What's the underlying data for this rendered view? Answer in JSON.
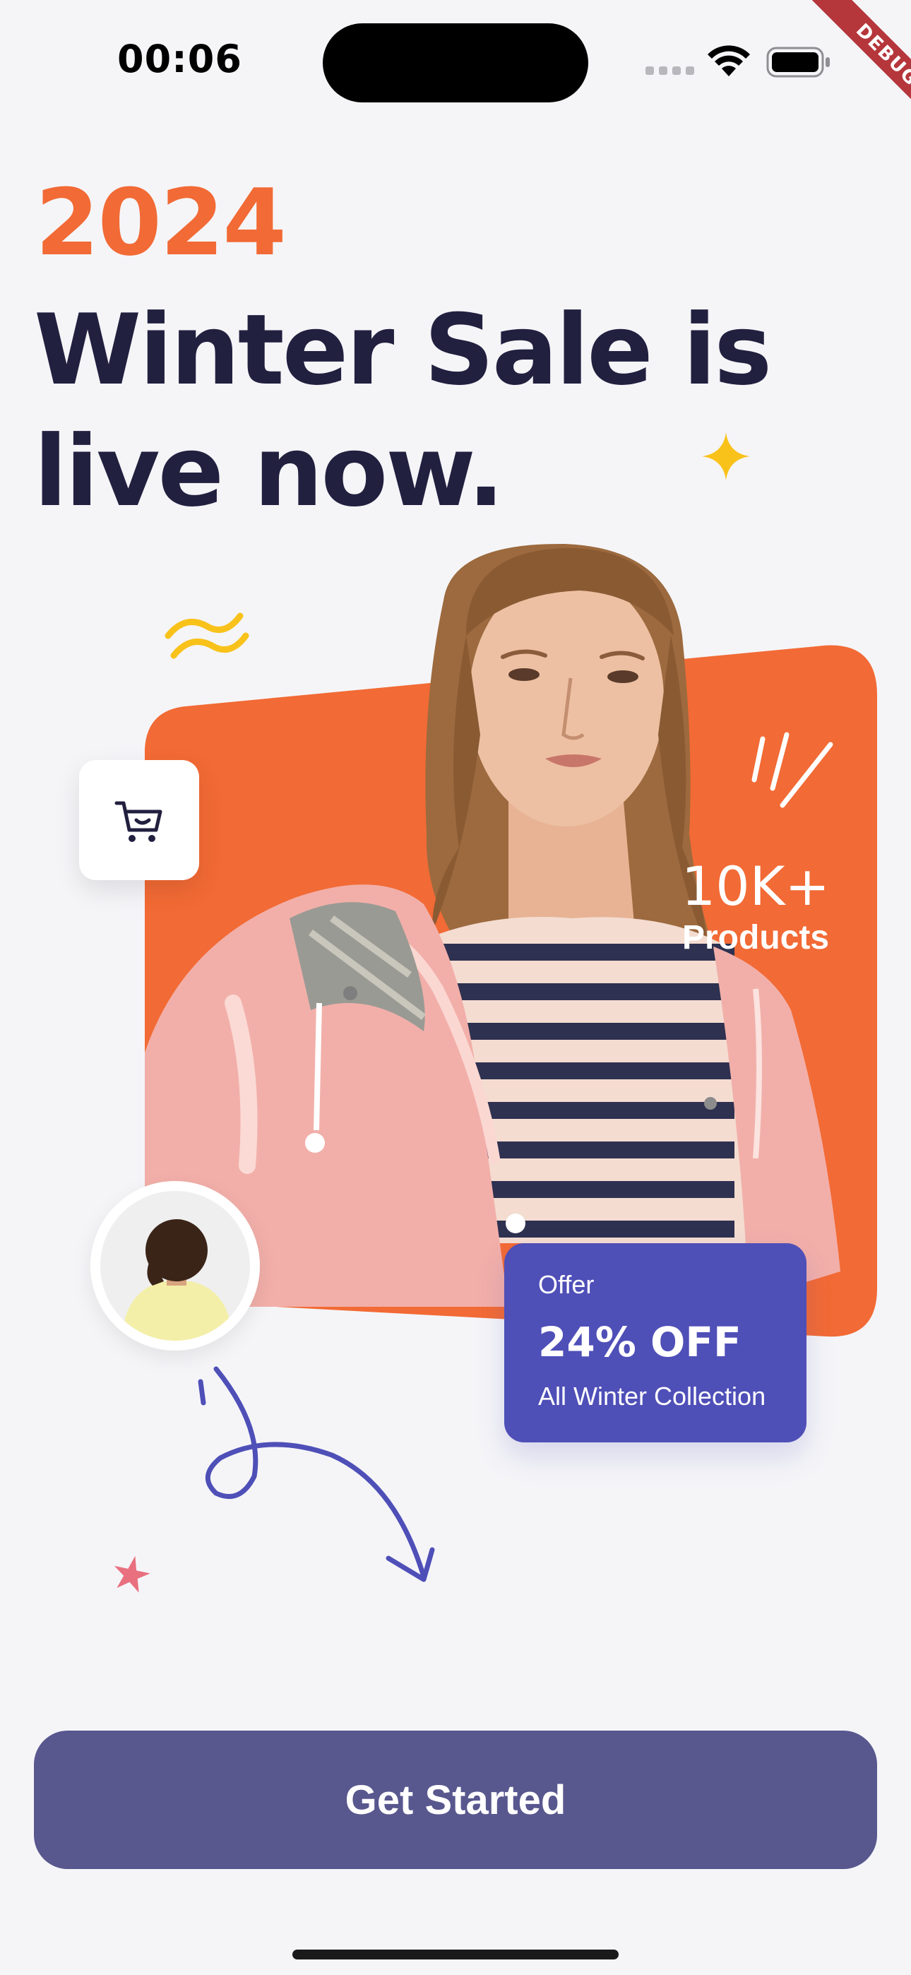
{
  "status_bar": {
    "time": "00:06",
    "debug_label": "DEBUG"
  },
  "headline": {
    "year": "2024",
    "title": "Winter Sale is live now."
  },
  "stats": {
    "value": "10K+",
    "label": "Products"
  },
  "offer": {
    "label": "Offer",
    "value": "24% OFF",
    "description": "All Winter Collection"
  },
  "cta": {
    "label": "Get Started"
  },
  "icons": {
    "cart": "cart-icon",
    "wifi": "wifi-icon",
    "battery": "battery-icon",
    "sparkle": "sparkle-icon"
  },
  "colors": {
    "accent_orange": "#F26A35",
    "headline_navy": "#22203F",
    "offer_purple": "#4F4FB8",
    "button_purple": "#58578E",
    "sparkle_yellow": "#F8C21B",
    "star_pink": "#E8707F",
    "background": "#F5F5F8"
  }
}
